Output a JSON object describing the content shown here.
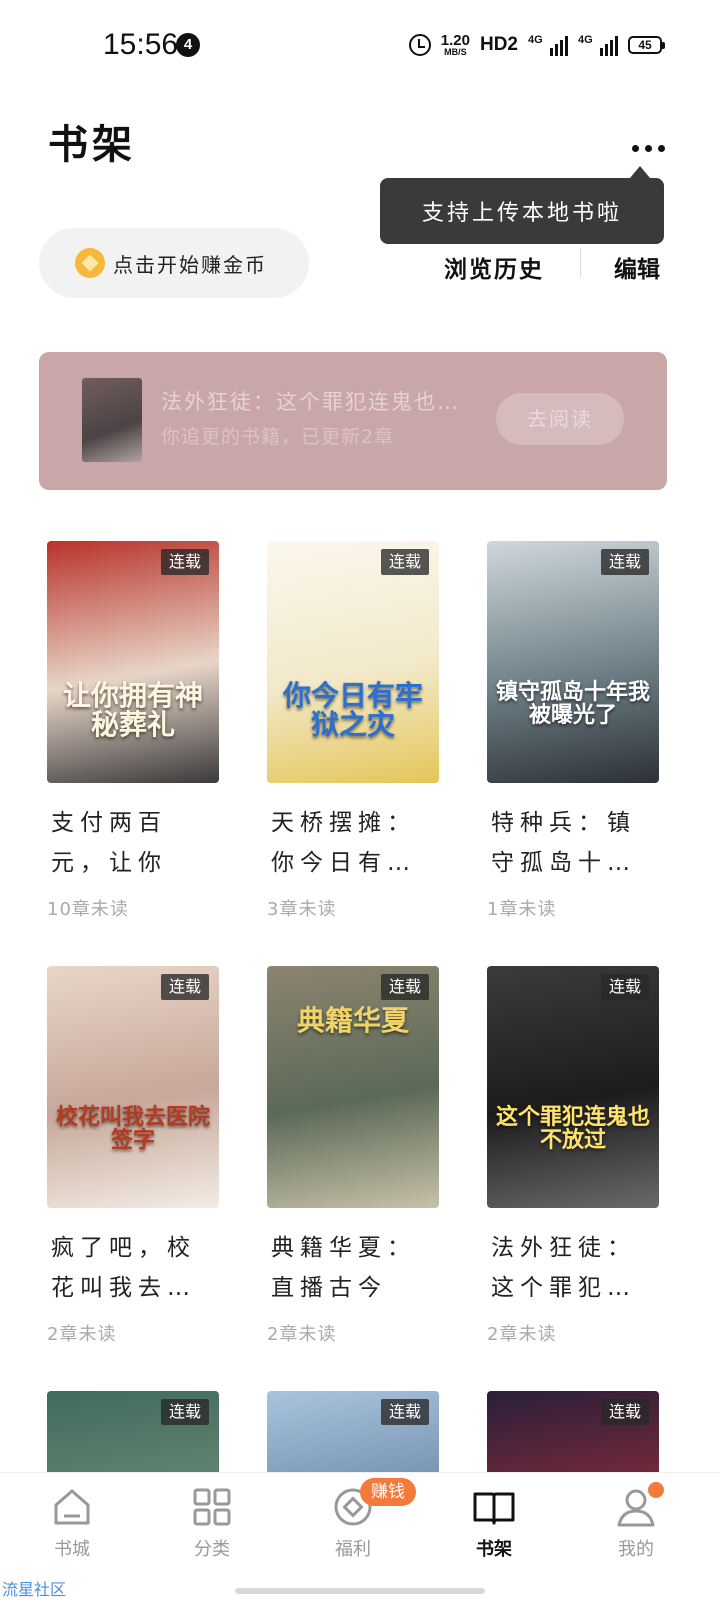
{
  "status_bar": {
    "time": "15:56",
    "notification_count": "4",
    "net_speed_value": "1.20",
    "net_speed_unit": "MB/S",
    "hd": "HD2",
    "signal_1": "4G",
    "signal_2": "4G",
    "battery": "45"
  },
  "header": {
    "title": "书架",
    "tooltip": "支持上传本地书啦",
    "earn_button": "点击开始赚金币",
    "history": "浏览历史",
    "edit": "编辑"
  },
  "continue_reading": {
    "title": "法外狂徒：这个罪犯连鬼也…",
    "subtitle": "你追更的书籍，已更新2章",
    "button": "去阅读"
  },
  "books": [
    {
      "title": "支付两百元，让你拥…",
      "progress": "10章未读",
      "tag": "连载",
      "cover_text": "让你拥有神秘葬礼",
      "cover_colors": [
        "#b8332a",
        "#e8d5c8",
        "#3a3a3a"
      ]
    },
    {
      "title": "天桥摆摊：你今日有…",
      "progress": "3章未读",
      "tag": "连载",
      "cover_text": "你今日有牢狱之灾",
      "cover_colors": [
        "#fbf7ee",
        "#f2e9c9",
        "#e5c65a"
      ]
    },
    {
      "title": "特种兵：镇守孤岛十…",
      "progress": "1章未读",
      "tag": "连载",
      "cover_text": "镇守孤岛十年我被曝光了",
      "cover_colors": [
        "#cfd8dc",
        "#6f8088",
        "#2c3236"
      ]
    },
    {
      "title": "疯了吧，校花叫我去…",
      "progress": "2章未读",
      "tag": "连载",
      "cover_text": "校花叫我去医院签字",
      "cover_colors": [
        "#e9d6c8",
        "#c7a89a",
        "#f3ece5"
      ]
    },
    {
      "title": "典籍华夏：直播古今",
      "progress": "2章未读",
      "tag": "连载",
      "cover_text": "典籍华夏",
      "cover_colors": [
        "#8c8470",
        "#5b6a58",
        "#c8c1a8"
      ]
    },
    {
      "title": "法外狂徒：这个罪犯…",
      "progress": "2章未读",
      "tag": "连载",
      "cover_text": "这个罪犯连鬼也不放过",
      "cover_colors": [
        "#3b3b3b",
        "#1c1c1c",
        "#6a6a6a"
      ]
    },
    {
      "title": "",
      "progress": "",
      "tag": "连载",
      "cover_text": "",
      "cover_colors": [
        "#3f6b5d",
        "#6d8a78",
        "#2b4a40"
      ]
    },
    {
      "title": "",
      "progress": "",
      "tag": "连载",
      "cover_text": "",
      "cover_colors": [
        "#a8c4de",
        "#6a86a6",
        "#dfe7ef"
      ]
    },
    {
      "title": "",
      "progress": "",
      "tag": "连载",
      "cover_text": "",
      "cover_colors": [
        "#2a1f3a",
        "#8a2b3b",
        "#d88a3c"
      ]
    }
  ],
  "bottom_nav": {
    "items": [
      {
        "label": "书城",
        "icon": "home-icon"
      },
      {
        "label": "分类",
        "icon": "grid-icon"
      },
      {
        "label": "福利",
        "icon": "coin-icon"
      },
      {
        "label": "书架",
        "icon": "book-icon"
      },
      {
        "label": "我的",
        "icon": "person-icon"
      }
    ],
    "earn_badge": "赚钱",
    "active": "书架"
  },
  "watermark": "流星社区"
}
